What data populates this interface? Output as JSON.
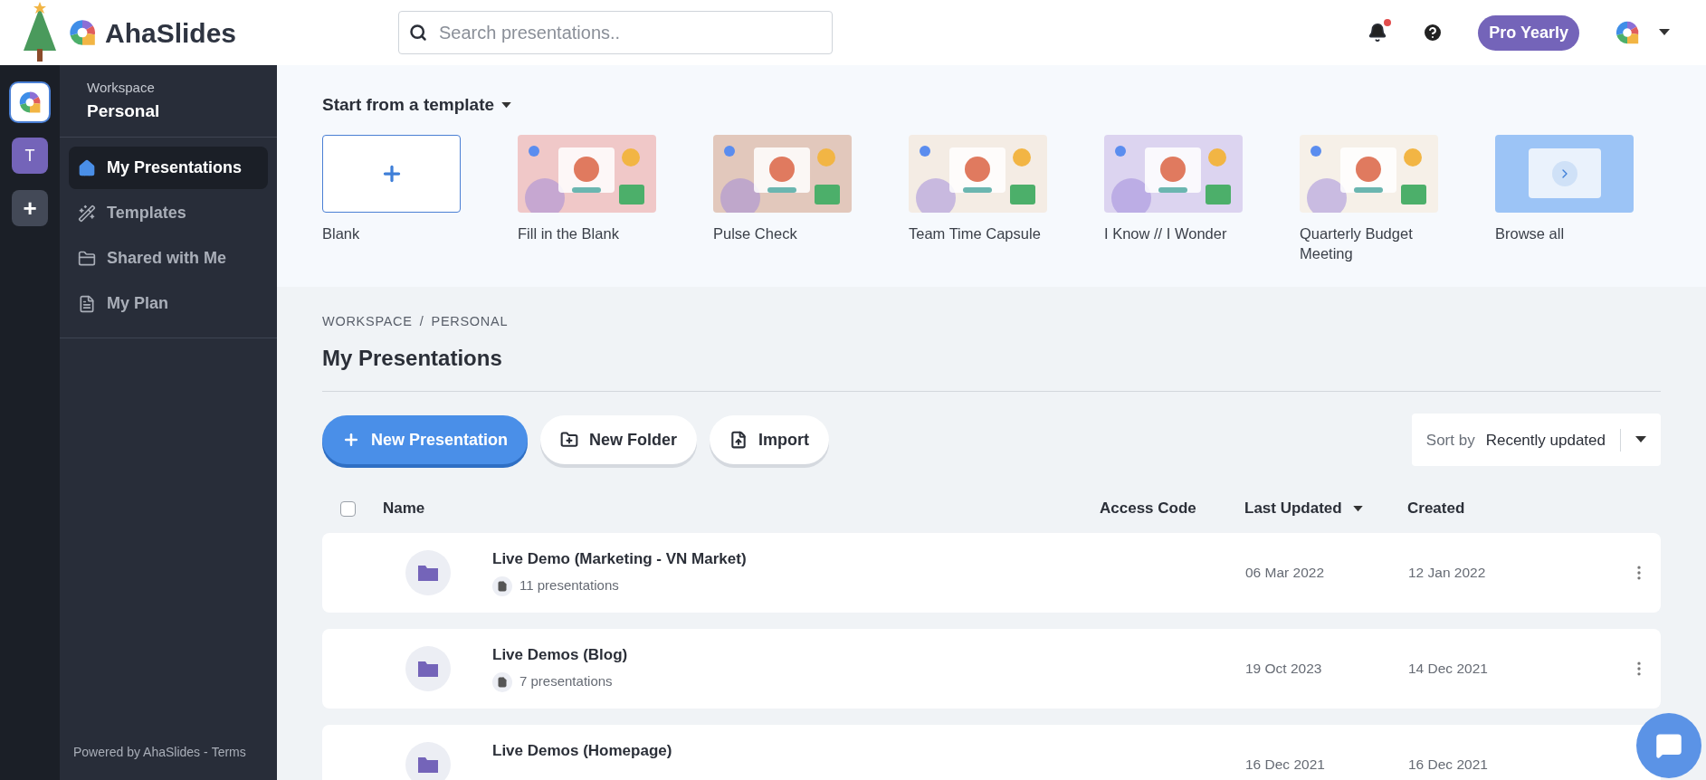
{
  "header": {
    "logo_text": "AhaSlides",
    "search": {
      "placeholder": "Search presentations.."
    },
    "notification_dot": true,
    "plan_badge": "Pro Yearly"
  },
  "rail": {
    "items": [
      {
        "kind": "logo",
        "selected": true
      },
      {
        "kind": "letter",
        "label": "T",
        "selected": false
      },
      {
        "kind": "add",
        "label": "+",
        "selected": false
      }
    ]
  },
  "sidebar": {
    "workspace_label": "Workspace",
    "workspace_name": "Personal",
    "items": [
      {
        "label": "My Presentations",
        "selected": true
      },
      {
        "label": "Templates",
        "selected": false
      },
      {
        "label": "Shared with Me",
        "selected": false
      },
      {
        "label": "My Plan",
        "selected": false
      }
    ],
    "footer": {
      "text": "Powered by AhaSlides -",
      "link": "Terms"
    }
  },
  "templates": {
    "title": "Start from a template",
    "items": [
      {
        "kind": "blank",
        "label": "Blank"
      },
      {
        "kind": "picture",
        "label": "Fill in the Blank"
      },
      {
        "kind": "picture",
        "label": "Pulse Check"
      },
      {
        "kind": "picture",
        "label": "Team Time Capsule"
      },
      {
        "kind": "picture",
        "label": "I Know // I Wonder"
      },
      {
        "kind": "picture",
        "label": "Quarterly Budget Meeting"
      },
      {
        "kind": "browse",
        "label": "Browse all"
      }
    ]
  },
  "breadcrumb": [
    "WORKSPACE",
    "/",
    "PERSONAL"
  ],
  "page_title": "My Presentations",
  "actions": [
    {
      "kind": "primary",
      "label": "New Presentation"
    },
    {
      "kind": "secondary",
      "label": "New Folder"
    },
    {
      "kind": "secondary",
      "label": "Import"
    }
  ],
  "sort": {
    "label": "Sort by",
    "value": "Recently updated"
  },
  "table": {
    "select_all_checked": false,
    "columns": [
      {
        "label": "Name",
        "sorted": false
      },
      {
        "label": "Access Code",
        "sorted": false
      },
      {
        "label": "Last Updated",
        "sorted": true
      },
      {
        "label": "Created",
        "sorted": false
      }
    ],
    "rows": [
      {
        "name": "Live Demo (Marketing - VN Market)",
        "count": "11 presentations",
        "last_updated": "06 Mar 2022",
        "created": "12 Jan 2022"
      },
      {
        "name": "Live Demos (Blog)",
        "count": "7 presentations",
        "last_updated": "19 Oct 2023",
        "created": "14 Dec 2021"
      },
      {
        "name": "Live Demos (Homepage)",
        "last_updated": "16 Dec 2021",
        "created": "16 Dec 2021"
      }
    ]
  }
}
